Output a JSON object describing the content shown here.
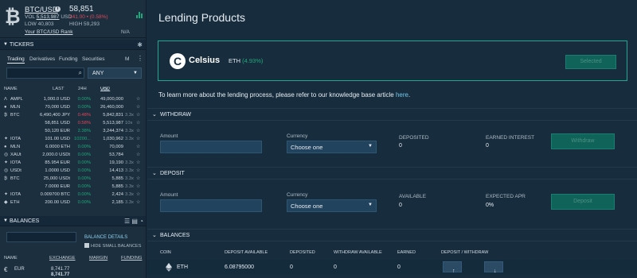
{
  "ticker_header": {
    "pair": "BTC/USD",
    "price": "58,851",
    "vol_label": "VOL",
    "vol_value": "5,513,987",
    "vol_unit": "USD",
    "change": "241.00 • (0.58%)",
    "low": "LOW 40,803",
    "high": "HIGH 59,293",
    "rank_link": "Your BTC/USD Rank",
    "rank_value": "N/A"
  },
  "tickers": {
    "title": "TICKERS",
    "tabs": [
      "Trading",
      "Derivatives",
      "Funding",
      "Securities"
    ],
    "menu_label": "M",
    "filter_value": "ANY",
    "columns": {
      "name": "NAME",
      "last": "LAST",
      "change_24h": "24H",
      "vol": "VOL",
      "vol_unit": "USD"
    },
    "rows": [
      {
        "icon": "Λ",
        "name": "AMPL",
        "last": "1,000.0 USD",
        "change": "0.00%",
        "dir": "up",
        "vol": "49,000,000",
        "mult": "",
        "star": "☆"
      },
      {
        "icon": "●",
        "name": "MLN",
        "last": "70,000 USD",
        "change": "0.00%",
        "dir": "up",
        "vol": "26,460,000",
        "mult": "",
        "star": "☆"
      },
      {
        "icon": "₿",
        "name": "BTC",
        "last": "6,490,400 JPY",
        "change": "0.48%",
        "dir": "dn",
        "vol": "5,842,831",
        "mult": "3.3x",
        "star": "☆"
      },
      {
        "icon": "",
        "name": "",
        "last": "58,851 USD",
        "change": "0.58%",
        "dir": "dn",
        "vol": "5,513,987",
        "mult": "10x",
        "star": "☆"
      },
      {
        "icon": "",
        "name": "",
        "last": "50,120 EUR",
        "change": "2.38%",
        "dir": "up",
        "vol": "3,244,374",
        "mult": "3.3x",
        "star": "☆"
      },
      {
        "icon": "✦",
        "name": "IOTA",
        "last": "101.00 USD",
        "change": "10200...",
        "dir": "up",
        "vol": "1,030,962",
        "mult": "3.3x",
        "star": "☆"
      },
      {
        "icon": "●",
        "name": "MLN",
        "last": "6.0000 ETH",
        "change": "0.00%",
        "dir": "up",
        "vol": "70,009",
        "mult": "",
        "star": "☆"
      },
      {
        "icon": "◎",
        "name": "XAUt",
        "last": "2,000.0 USDt",
        "change": "0.00%",
        "dir": "up",
        "vol": "53,784",
        "mult": "",
        "star": "☆"
      },
      {
        "icon": "✦",
        "name": "IOTA",
        "last": "85.954 EUR",
        "change": "0.00%",
        "dir": "up",
        "vol": "19,190",
        "mult": "3.3x",
        "star": "☆"
      },
      {
        "icon": "◎",
        "name": "USDt",
        "last": "1.0000 USD",
        "change": "0.00%",
        "dir": "up",
        "vol": "14,413",
        "mult": "3.3x",
        "star": "☆"
      },
      {
        "icon": "₿",
        "name": "BTC",
        "last": "25,000 USDt",
        "change": "0.00%",
        "dir": "up",
        "vol": "5,885",
        "mult": "3.3x",
        "star": "☆"
      },
      {
        "icon": "",
        "name": "",
        "last": "7.0000 EUR",
        "change": "0.00%",
        "dir": "up",
        "vol": "5,885",
        "mult": "3.3x",
        "star": "☆"
      },
      {
        "icon": "✦",
        "name": "IOTA",
        "last": "0.009700 BTC",
        "change": "0.00%",
        "dir": "up",
        "vol": "2,424",
        "mult": "3.3x",
        "star": "☆"
      },
      {
        "icon": "◆",
        "name": "ETH",
        "last": "200.00 USD",
        "change": "0.00%",
        "dir": "up",
        "vol": "2,185",
        "mult": "3.3x",
        "star": "☆"
      }
    ]
  },
  "balances_panel": {
    "title": "BALANCES",
    "details_link": "BALANCE DETAILS",
    "hide_small": "HIDE SMALL BALANCES",
    "columns": {
      "name": "NAME",
      "exchange": "EXCHANGE",
      "margin": "MARGIN",
      "funding": "FUNDING"
    },
    "rows": [
      {
        "name": "EUR",
        "exchange": "8,741.77"
      },
      {
        "name": "",
        "exchange": "8,741.77"
      }
    ]
  },
  "main": {
    "title": "Lending Products",
    "provider": {
      "name": "Celsius",
      "asset": "ETH",
      "apr": "(4.93%)",
      "button": "Selected"
    },
    "info_text": "To learn more about the lending process, please refer to our knowledge base article ",
    "info_link": "here",
    "info_end": ".",
    "withdraw": {
      "title": "WITHDRAW",
      "amount_label": "Amount",
      "currency_label": "Currency",
      "currency_value": "Choose one",
      "deposited_label": "DEPOSITED",
      "deposited_value": "0",
      "earned_label": "EARNED INTEREST",
      "earned_value": "0",
      "button": "Withdraw"
    },
    "deposit": {
      "title": "DEPOSIT",
      "amount_label": "Amount",
      "currency_label": "Currency",
      "currency_value": "Choose one",
      "available_label": "AVAILABLE",
      "available_value": "0",
      "apr_label": "EXPECTED APR",
      "apr_value": "0%",
      "button": "Deposit"
    },
    "balances": {
      "title": "BALANCES",
      "columns": [
        "COIN",
        "DEPOSIT AVAILABLE",
        "DEPOSITED",
        "WITHDRAW AVAILABLE",
        "EARNED",
        "DEPOSIT / WITHDRAW"
      ],
      "row": {
        "coin": "ETH",
        "deposit_available": "6.08795000",
        "deposited": "0",
        "withdraw_available": "0",
        "earned": "0"
      }
    }
  },
  "colors": {
    "positive": "#21a87a",
    "negative": "#e0475a",
    "accent_border": "#1fa790",
    "button_bg": "#0f6358"
  }
}
